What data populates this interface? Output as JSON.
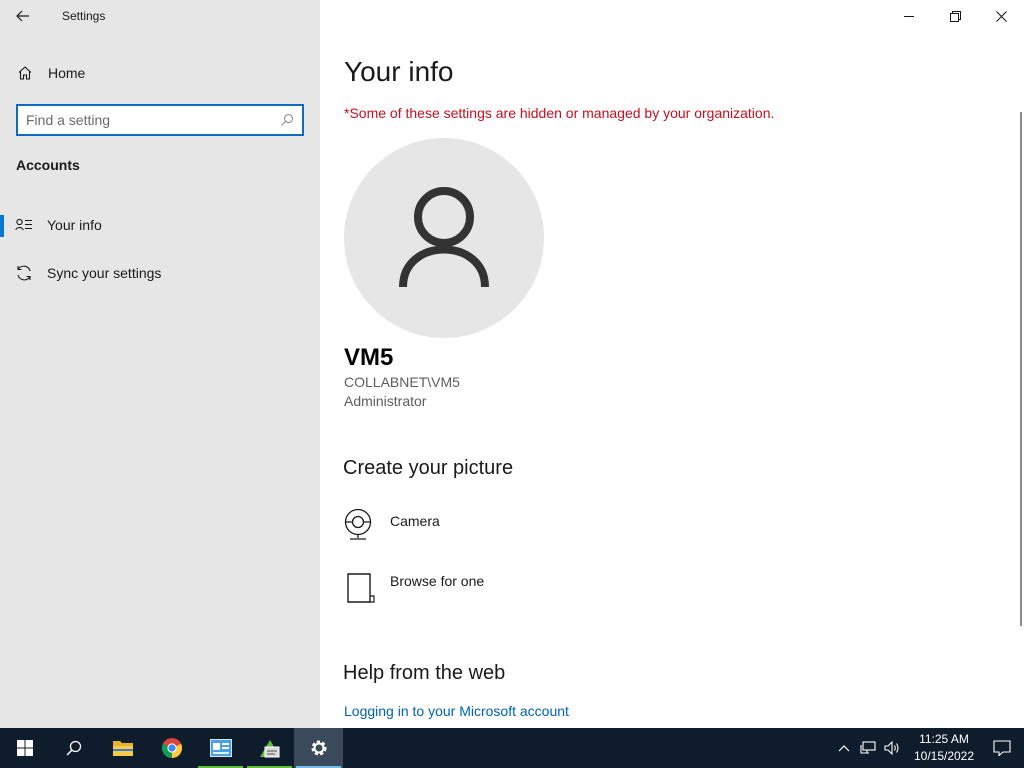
{
  "window": {
    "title": "Settings"
  },
  "sidebar": {
    "home_label": "Home",
    "search_placeholder": "Find a setting",
    "section_title": "Accounts",
    "items": [
      {
        "label": "Your info",
        "icon": "your-info-icon",
        "active": true
      },
      {
        "label": "Sync your settings",
        "icon": "sync-icon",
        "active": false
      }
    ]
  },
  "main": {
    "title": "Your info",
    "warning": "*Some of these settings are hidden or managed by your organization.",
    "user": {
      "name": "VM5",
      "account": "COLLABNET\\VM5",
      "role": "Administrator"
    },
    "create_picture": {
      "heading": "Create your picture",
      "options": [
        {
          "label": "Camera",
          "icon": "camera-icon"
        },
        {
          "label": "Browse for one",
          "icon": "browse-file-icon"
        }
      ]
    },
    "help": {
      "heading": "Help from the web",
      "link": "Logging in to your Microsoft account"
    }
  },
  "taskbar": {
    "apps": [
      "start",
      "search",
      "file-explorer",
      "chrome",
      "app-window",
      "app-green",
      "settings"
    ],
    "time": "11:25 AM",
    "date": "10/15/2022"
  },
  "colors": {
    "accent": "#0078d4",
    "warning": "#c50f1f",
    "link": "#0063b1",
    "sidebar_bg": "#e6e6e6",
    "taskbar_bg": "#0e1c2c"
  }
}
